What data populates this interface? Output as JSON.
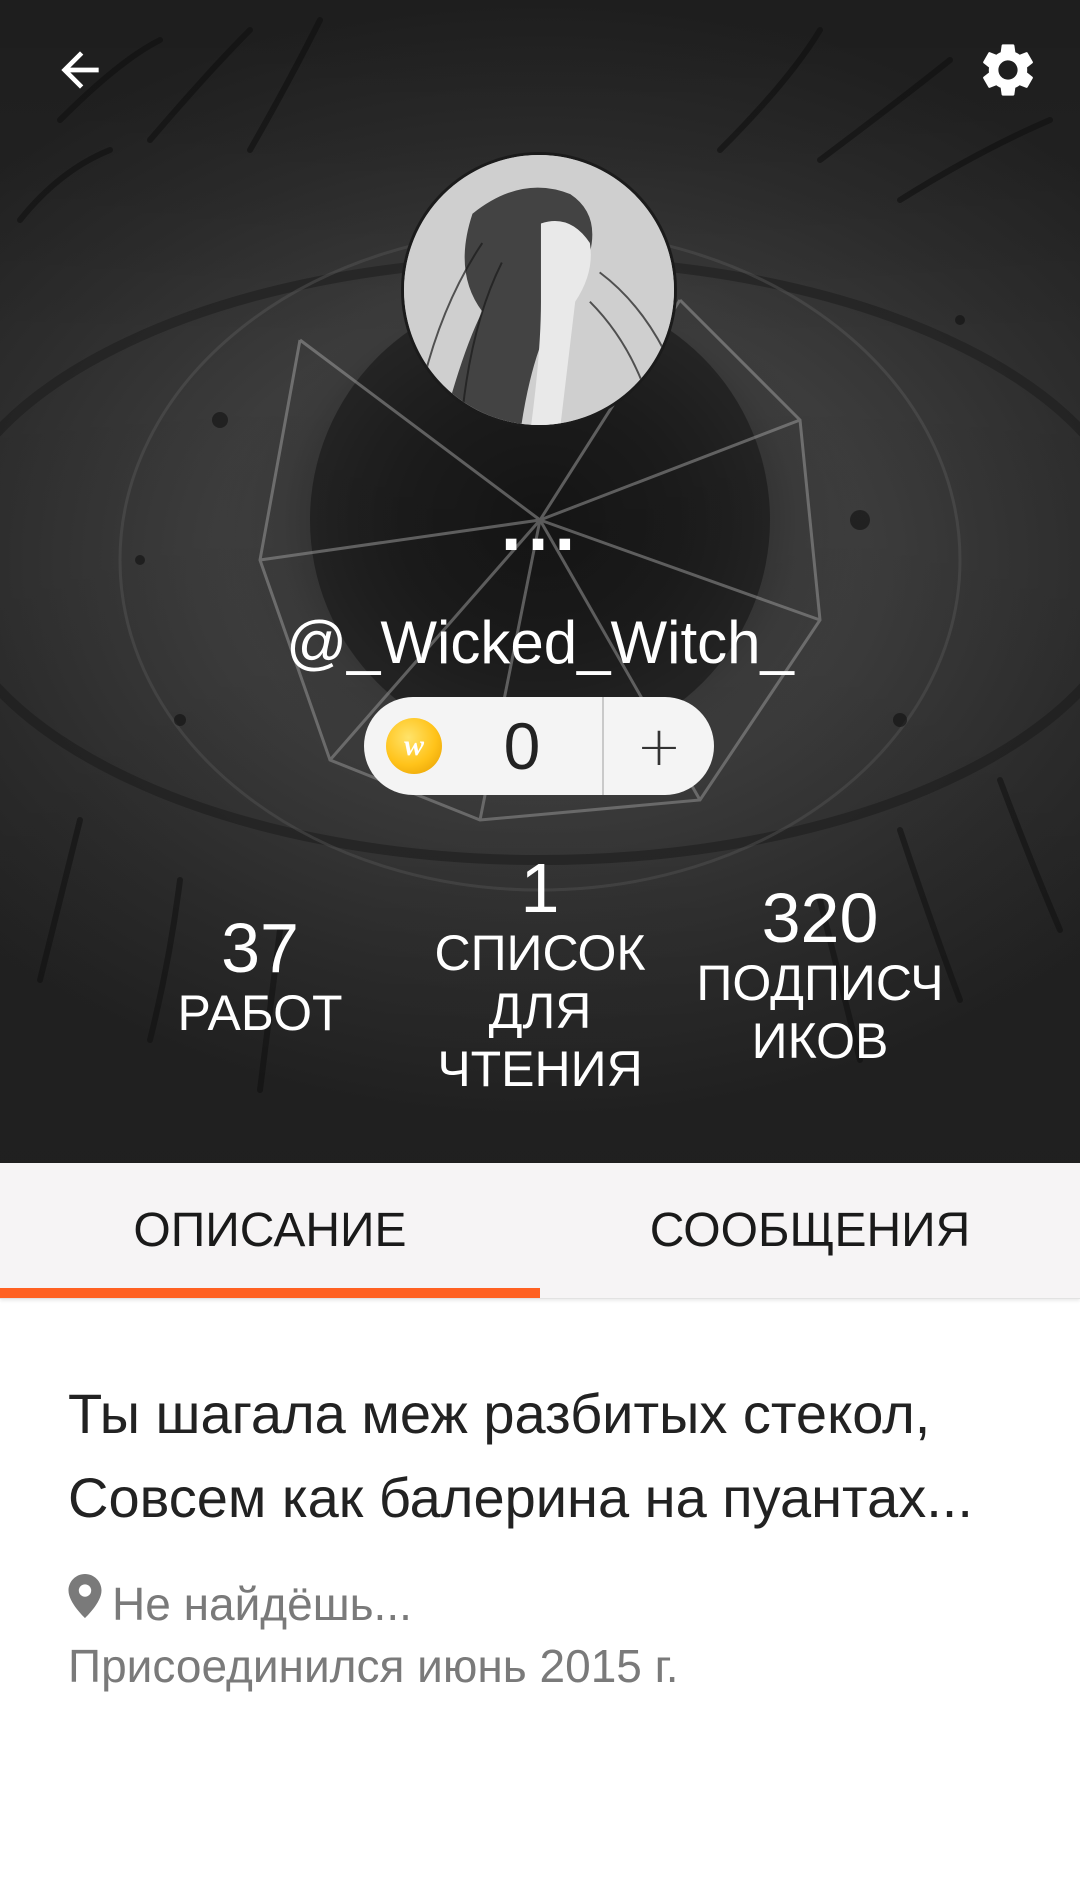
{
  "profile": {
    "display_name": "...",
    "username": "@_Wicked_Witch_",
    "coins": {
      "icon": "wattpad-coin-icon",
      "icon_letter": "w",
      "count": "0",
      "add_label": "+"
    }
  },
  "stats": {
    "works": {
      "value": "37",
      "label": "РАБОТ"
    },
    "reading_lists": {
      "value": "1",
      "label": "СПИСОК ДЛЯ ЧТЕНИЯ"
    },
    "followers": {
      "value": "320",
      "label": "ПОДПИСЧИКОВ"
    }
  },
  "tabs": [
    {
      "label": "ОПИСАНИЕ",
      "active": true
    },
    {
      "label": "СООБЩЕНИЯ",
      "active": false
    }
  ],
  "about": {
    "bio": "Ты шагала меж разбитых стекол, Совсем как балерина на пуантах...",
    "location": "Не найдёшь...",
    "joined": "Присоединился июнь 2015 г."
  },
  "icons": {
    "back": "arrow-left-icon",
    "settings": "gear-icon",
    "location": "map-pin-icon"
  },
  "colors": {
    "accent": "#ff6122",
    "tab_bg": "#f6f4f5",
    "muted_text": "#7a7a7a"
  }
}
